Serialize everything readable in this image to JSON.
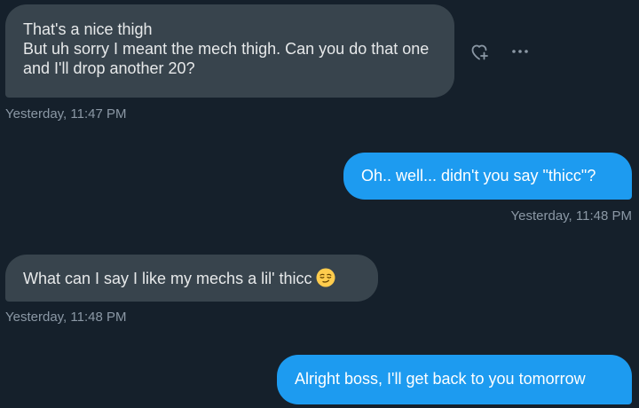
{
  "messages": [
    {
      "side": "received",
      "text": "That's a nice thigh\nBut uh sorry I meant the mech thigh. Can you do that one and I'll drop another 20?",
      "timestamp": "Yesterday, 11:47 PM"
    },
    {
      "side": "sent",
      "text": "Oh.. well... didn't you say \"thicc\"?",
      "timestamp": "Yesterday, 11:48 PM"
    },
    {
      "side": "received",
      "text": "What can I say I like my mechs a lil' thicc",
      "emoji": "smirking-face",
      "timestamp": "Yesterday, 11:48 PM"
    },
    {
      "side": "sent",
      "text": "Alright boss, I'll get back to you tomorrow"
    }
  ],
  "actions": {
    "react_icon": "heart-plus-icon",
    "more_icon": "more-horizontal-icon"
  },
  "colors": {
    "background": "#15202b",
    "received_bubble": "#38444d",
    "sent_bubble": "#1d9bf0",
    "timestamp": "#8b98a5",
    "text": "#e7e9ea"
  }
}
